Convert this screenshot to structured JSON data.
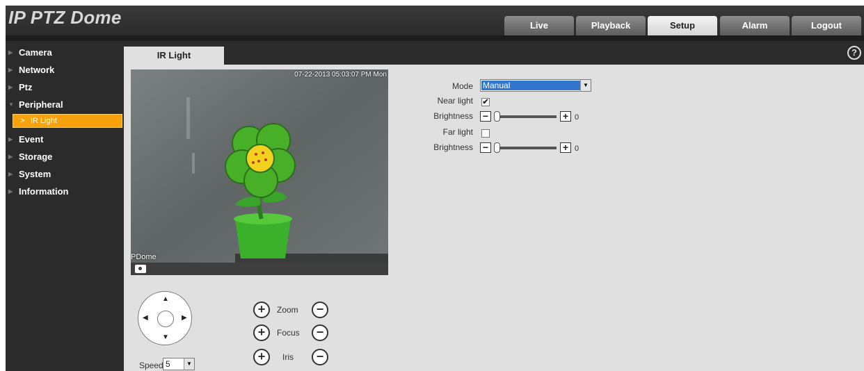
{
  "app": {
    "title": "IP PTZ Dome"
  },
  "top_nav": [
    {
      "label": "Live",
      "active": false
    },
    {
      "label": "Playback",
      "active": false
    },
    {
      "label": "Setup",
      "active": true
    },
    {
      "label": "Alarm",
      "active": false
    },
    {
      "label": "Logout",
      "active": false
    }
  ],
  "sidebar": {
    "items": [
      {
        "label": "Camera"
      },
      {
        "label": "Network"
      },
      {
        "label": "Ptz"
      },
      {
        "label": "Peripheral",
        "expanded": true
      },
      {
        "label": "Event"
      },
      {
        "label": "Storage"
      },
      {
        "label": "System"
      },
      {
        "label": "Information"
      }
    ],
    "subitem": {
      "label": "IR Light",
      "arrow": ">"
    }
  },
  "content": {
    "tab_label": "IR Light",
    "help_icon": "?"
  },
  "video": {
    "timestamp": "07-22-2013 05:03:07 PM Mon",
    "channel_name": "PDome"
  },
  "ptz": {
    "zoom_label": "Zoom",
    "focus_label": "Focus",
    "iris_label": "Iris",
    "plus": "+",
    "minus": "−",
    "speed_label": "Speed",
    "speed_value": "5"
  },
  "form": {
    "mode_label": "Mode",
    "mode_value": "Manual",
    "near_light_label": "Near light",
    "near_light_checked": true,
    "brightness1_label": "Brightness",
    "brightness1_value": "0",
    "far_light_label": "Far light",
    "far_light_checked": false,
    "brightness2_label": "Brightness",
    "brightness2_value": "0",
    "check_mark": "✔"
  },
  "colors": {
    "accent": "#f7a20d",
    "selection": "#3276d0",
    "background": "#2b2b2b"
  }
}
